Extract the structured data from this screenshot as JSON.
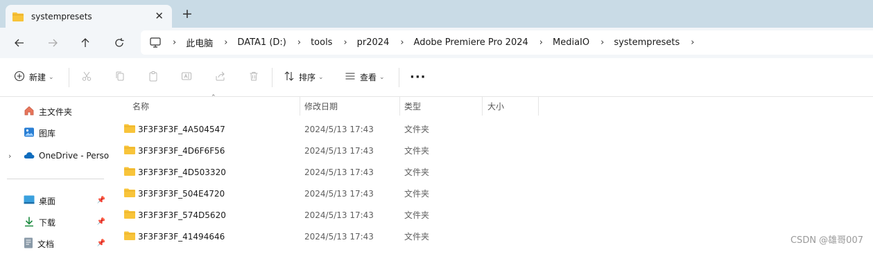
{
  "tab": {
    "title": "systempresets",
    "close": "✕",
    "new": "+"
  },
  "address": {
    "crumbs": [
      "此电脑",
      "DATA1 (D:)",
      "tools",
      "pr2024",
      "Adobe Premiere Pro 2024",
      "MediaIO",
      "systempresets"
    ],
    "separator": "›"
  },
  "commands": {
    "new": "新建",
    "sort": "排序",
    "view": "查看",
    "more": "···"
  },
  "sidebar": {
    "home": "主文件夹",
    "gallery": "图库",
    "onedrive": "OneDrive - Perso",
    "desktop": "桌面",
    "downloads": "下载",
    "documents": "文档"
  },
  "columns": {
    "name": "名称",
    "date": "修改日期",
    "type": "类型",
    "size": "大小"
  },
  "files": [
    {
      "name": "3F3F3F3F_4A504547",
      "date": "2024/5/13 17:43",
      "type": "文件夹"
    },
    {
      "name": "3F3F3F3F_4D6F6F56",
      "date": "2024/5/13 17:43",
      "type": "文件夹"
    },
    {
      "name": "3F3F3F3F_4D503320",
      "date": "2024/5/13 17:43",
      "type": "文件夹"
    },
    {
      "name": "3F3F3F3F_504E4720",
      "date": "2024/5/13 17:43",
      "type": "文件夹"
    },
    {
      "name": "3F3F3F3F_574D5620",
      "date": "2024/5/13 17:43",
      "type": "文件夹"
    },
    {
      "name": "3F3F3F3F_41494646",
      "date": "2024/5/13 17:43",
      "type": "文件夹"
    }
  ],
  "watermark": "CSDN @雄哥007",
  "colors": {
    "titlebar": "#c9dbe6",
    "folder": "#f8c43a",
    "folder_dark": "#e5a823",
    "onedrive": "#0f6cbd"
  }
}
